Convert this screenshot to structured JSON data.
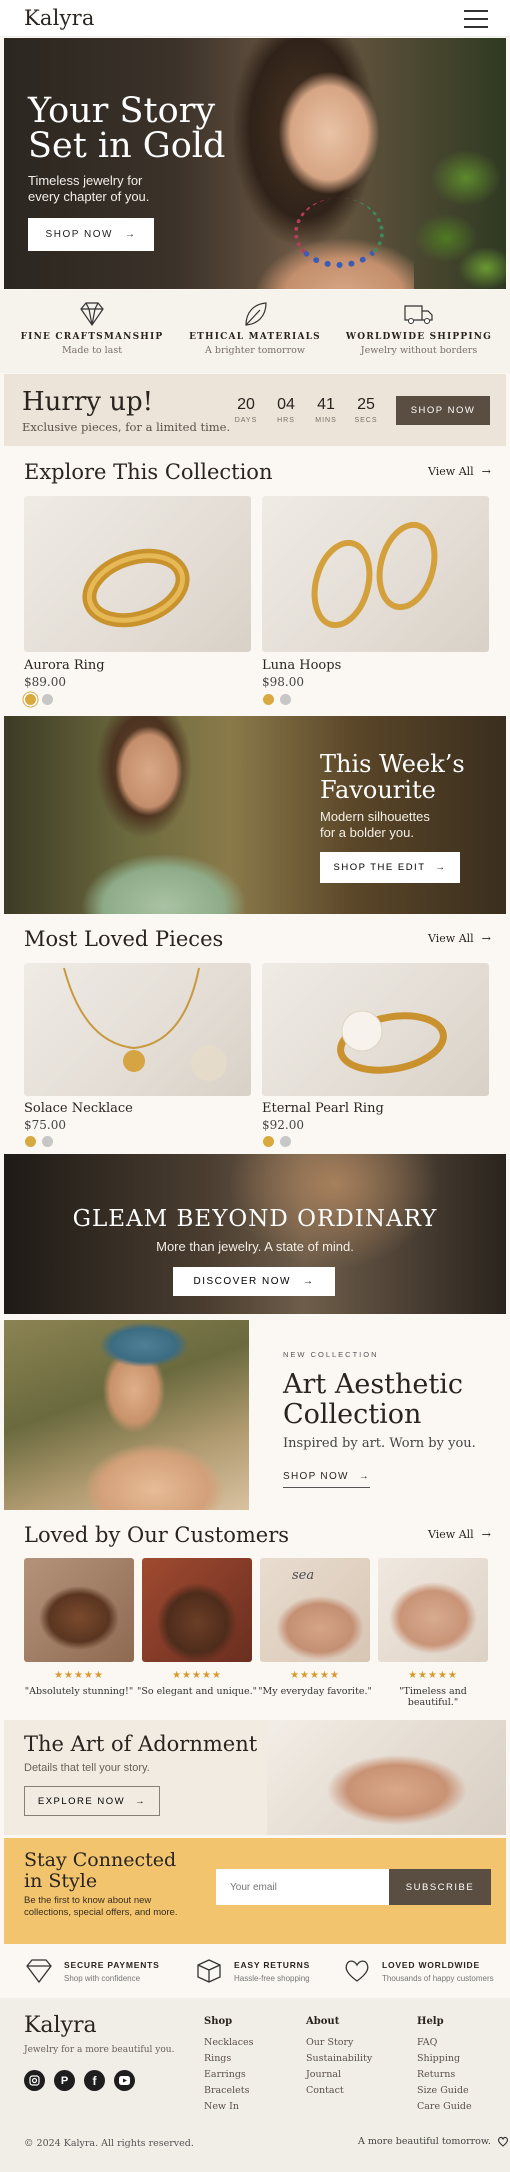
{
  "header": {
    "logo": "Kalyra",
    "menu_icon": "hamburger-menu-icon"
  },
  "hero": {
    "title_line1": "Your Story",
    "title_line2": "Set in Gold",
    "subtitle_line1": "Timeless jewelry for",
    "subtitle_line2": "every chapter of you.",
    "button": "SHOP NOW"
  },
  "features": [
    {
      "icon": "diamond-icon",
      "title": "FINE CRAFTSMANSHIP",
      "desc": "Made to last"
    },
    {
      "icon": "leaf-icon",
      "title": "ETHICAL MATERIALS",
      "desc": "A brighter tomorrow"
    },
    {
      "icon": "truck-icon",
      "title": "WORLDWIDE SHIPPING",
      "desc": "Jewelry without borders"
    }
  ],
  "countdown": {
    "title": "Hurry up!",
    "subtitle": "Exclusive pieces, for a limited time.",
    "units": [
      {
        "value": "20",
        "label": "DAYS"
      },
      {
        "value": "04",
        "label": "HRS"
      },
      {
        "value": "41",
        "label": "MINS"
      },
      {
        "value": "25",
        "label": "SECS"
      }
    ],
    "button": "SHOP NOW"
  },
  "collection": {
    "title": "Explore This Collection",
    "view_all": "View All",
    "products": [
      {
        "name": "Aurora Ring",
        "price": "$89.00",
        "swatches": [
          "#d8a93f",
          "#c7c7c7"
        ],
        "selected": 0
      },
      {
        "name": "Luna Hoops",
        "price": "$98.00",
        "swatches": [
          "#d8a93f",
          "#c7c7c7"
        ],
        "selected": -1
      }
    ]
  },
  "week": {
    "title_line1": "This Week’s",
    "title_line2": "Favourite",
    "subtitle_line1": "Modern silhouettes",
    "subtitle_line2": "for a bolder you.",
    "button": "SHOP THE EDIT"
  },
  "loved": {
    "title": "Most Loved Pieces",
    "view_all": "View All",
    "products": [
      {
        "name": "Solace Necklace",
        "price": "$75.00",
        "swatches": [
          "#d8a93f",
          "#c7c7c7"
        ]
      },
      {
        "name": "Eternal Pearl Ring",
        "price": "$92.00",
        "swatches": [
          "#d8a93f",
          "#c7c7c7"
        ]
      }
    ]
  },
  "gleam": {
    "title": "GLEAM BEYOND ORDINARY",
    "subtitle": "More than jewelry. A state of mind.",
    "button": "DISCOVER NOW"
  },
  "art": {
    "kicker": "NEW COLLECTION",
    "title_line1": "Art Aesthetic",
    "title_line2": "Collection",
    "subtitle": "Inspired by art. Worn by you.",
    "link": "SHOP NOW"
  },
  "reviews": {
    "title": "Loved by Our Customers",
    "view_all": "View All",
    "items": [
      {
        "stars": "★★★★★",
        "quote": "\"Absolutely stunning!\""
      },
      {
        "stars": "★★★★★",
        "quote": "\"So elegant and unique.\""
      },
      {
        "stars": "★★★★★",
        "quote": "\"My everyday favorite.\""
      },
      {
        "stars": "★★★★★",
        "quote": "\"Timeless and beautiful.\""
      }
    ],
    "tattoo_text": "sea"
  },
  "adorn": {
    "title": "The Art of Adornment",
    "subtitle": "Details that tell your story.",
    "button": "EXPLORE NOW"
  },
  "newsletter": {
    "title_line1": "Stay Connected",
    "title_line2": "in Style",
    "subtitle": "Be the first to know about new collections, special offers, and more.",
    "placeholder": "Your email",
    "button": "SUBSCRIBE"
  },
  "trust": [
    {
      "icon": "diamond-icon",
      "title": "SECURE PAYMENTS",
      "desc": "Shop with confidence"
    },
    {
      "icon": "box-icon",
      "title": "EASY RETURNS",
      "desc": "Hassle-free shopping"
    },
    {
      "icon": "heart-icon",
      "title": "LOVED WORLDWIDE",
      "desc": "Thousands of happy customers"
    }
  ],
  "footer": {
    "logo": "Kalyra",
    "tagline": "Jewelry for a more beautiful you.",
    "social": [
      "instagram-icon",
      "pinterest-icon",
      "facebook-icon",
      "youtube-icon"
    ],
    "columns": [
      {
        "heading": "Shop",
        "links": [
          "Necklaces",
          "Rings",
          "Earrings",
          "Bracelets",
          "New In"
        ]
      },
      {
        "heading": "About",
        "links": [
          "Our Story",
          "Sustainability",
          "Journal",
          "Contact"
        ]
      },
      {
        "heading": "Help",
        "links": [
          "FAQ",
          "Shipping",
          "Returns",
          "Size Guide",
          "Care Guide"
        ]
      }
    ],
    "copyright": "© 2024 Kalyra. All rights reserved.",
    "right_text": "A more beautiful tomorrow."
  },
  "colors": {
    "accent_brown": "#5a4d41",
    "gold": "#d8a93f",
    "newsletter_bg": "#f1c46d",
    "star": "#d99a2b"
  }
}
